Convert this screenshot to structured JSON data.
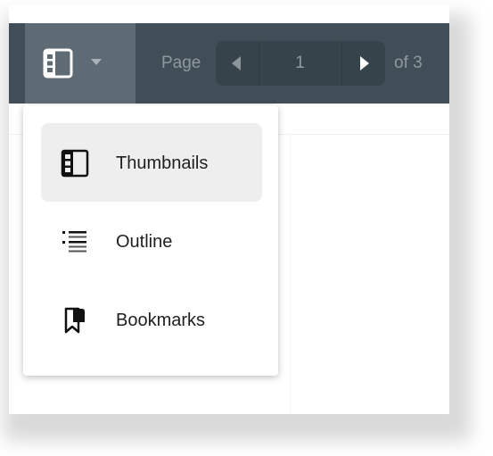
{
  "toolbar": {
    "page_label": "Page",
    "current_page": "1",
    "of_label": "of 3",
    "sidebar_toggle_icon": "sidebar-panel-icon",
    "dropdown_caret_icon": "caret-down-icon",
    "prev_icon": "triangle-left-icon",
    "next_icon": "triangle-right-icon"
  },
  "sidebar_menu": {
    "items": [
      {
        "label": "Thumbnails",
        "icon": "thumbnails-icon",
        "selected": true
      },
      {
        "label": "Outline",
        "icon": "outline-icon",
        "selected": false
      },
      {
        "label": "Bookmarks",
        "icon": "bookmark-icon",
        "selected": false
      }
    ]
  },
  "colors": {
    "toolbar_bg": "#414e57",
    "toggle_bg": "#5e6b74",
    "pager_bg": "#37434b",
    "selected_item_bg": "#eeeeee"
  }
}
